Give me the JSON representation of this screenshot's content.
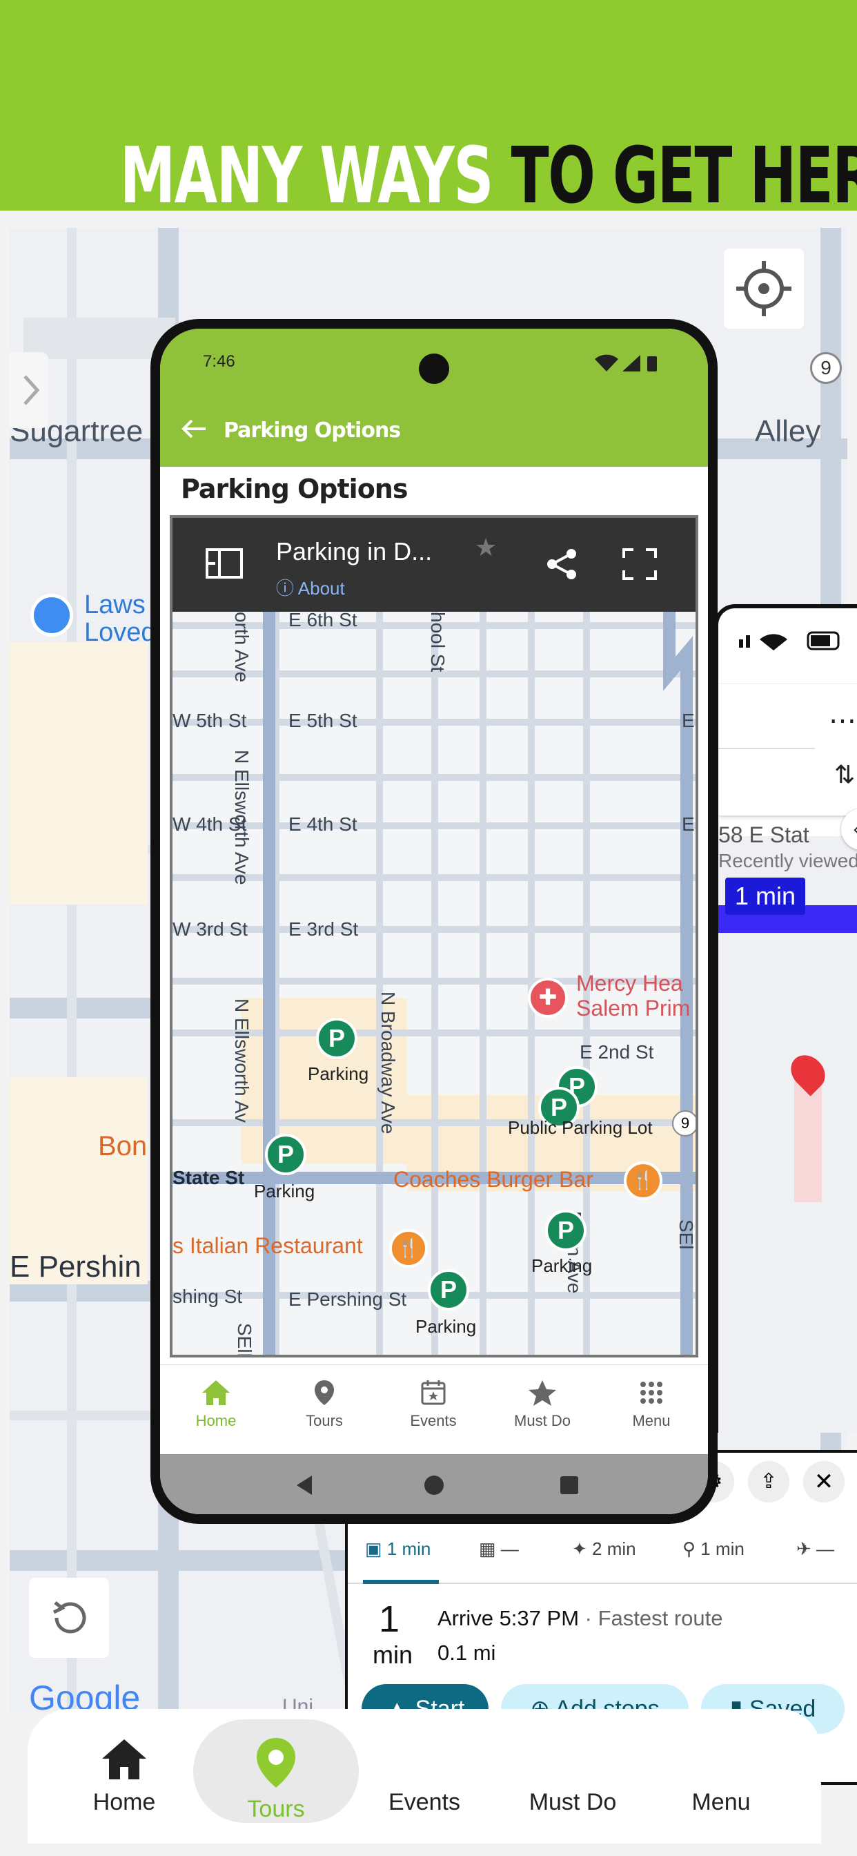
{
  "banner": {
    "headline_white": "MANY WAYS",
    "headline_black": "TO GET HERE",
    "bg_color": "#8fcb2f"
  },
  "background_map": {
    "streets": [
      "Sugartree",
      "Alley",
      "E Pershin",
      "Bon",
      "Laws",
      "Loved"
    ],
    "route_badge": "9",
    "logo": "Google",
    "partial_label": "Uni"
  },
  "bottom_nav": {
    "items": [
      {
        "label": "Home",
        "icon": "home-icon"
      },
      {
        "label": "Tours",
        "icon": "location-pin-icon",
        "active": true
      },
      {
        "label": "Events",
        "icon": "calendar-icon"
      },
      {
        "label": "Must Do",
        "icon": "star-icon"
      },
      {
        "label": "Menu",
        "icon": "grid-icon"
      }
    ],
    "active_color": "#8fcb2f"
  },
  "phone": {
    "status_time": "7:46",
    "appbar_title": "Parking Options",
    "page_title": "Parking  Options",
    "embed": {
      "title": "Parking in D...",
      "about": "About",
      "map": {
        "streets": [
          "E 6th St",
          "W 5th St",
          "E 5th St",
          "W 4th St",
          "E 4th St",
          "W 3rd St",
          "E 3rd St",
          "E 2nd St",
          "State St",
          "E Pershing St",
          "shing St",
          "N Ellsworth Ave",
          "N Ellsworth Av",
          "N Broadway Ave",
          "orth Ave",
          "hool St",
          "Penn Ave",
          "SElli",
          "SEl",
          "E",
          "E",
          "9"
        ],
        "poi": [
          "Mercy Hea",
          "Salem Prim",
          "Coaches Burger Bar",
          "s Italian Restaurant"
        ],
        "parking_labels": [
          "Parking",
          "Parking",
          "Public Parking Lot",
          "Parking",
          "Parking"
        ],
        "parking_glyph": "P"
      }
    },
    "app_nav": [
      {
        "label": "Home",
        "icon": "home-icon",
        "active": true
      },
      {
        "label": "Tours",
        "icon": "location-pin-icon"
      },
      {
        "label": "Events",
        "icon": "calendar-icon"
      },
      {
        "label": "Must Do",
        "icon": "star-icon"
      },
      {
        "label": "Menu",
        "icon": "grid-icon"
      }
    ],
    "accent": "#8fc23a"
  },
  "google_maps_phone": {
    "place": "58 E Stat",
    "recent": "Recently viewed",
    "eta_badge": "1 min"
  },
  "directions": {
    "modes": [
      {
        "label": "1 min",
        "icon": "car-icon",
        "active": true
      },
      {
        "label": "—",
        "icon": "transit-icon"
      },
      {
        "label": "2 min",
        "icon": "walk-icon"
      },
      {
        "label": "1 min",
        "icon": "bike-icon"
      },
      {
        "label": "—",
        "icon": "plane-icon"
      }
    ],
    "duration_num": "1",
    "duration_unit": "min",
    "arrive": "Arrive 5:37 PM",
    "route_note": " · Fastest route",
    "distance": "0.1 mi",
    "buttons": {
      "start": "Start",
      "add_stops": "Add stops",
      "saved": "Saved"
    }
  }
}
